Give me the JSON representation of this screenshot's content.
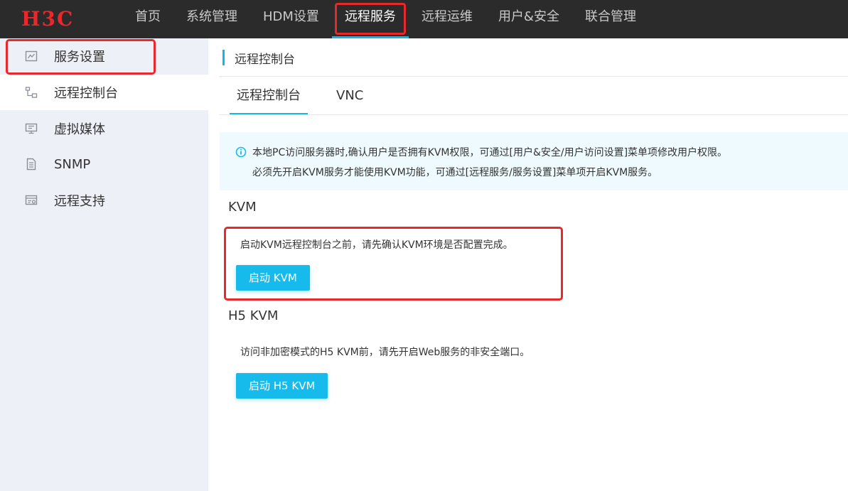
{
  "logo": {
    "text": "H3C",
    "color": "#e8282a"
  },
  "nav": {
    "items": [
      {
        "label": "首页"
      },
      {
        "label": "系统管理"
      },
      {
        "label": "HDM设置"
      },
      {
        "label": "远程服务",
        "active": true
      },
      {
        "label": "远程运维"
      },
      {
        "label": "用户&安全"
      },
      {
        "label": "联合管理"
      }
    ]
  },
  "sidebar": {
    "items": [
      {
        "label": "服务设置",
        "icon": "service-settings-icon"
      },
      {
        "label": "远程控制台",
        "icon": "remote-console-icon",
        "active": true
      },
      {
        "label": "虚拟媒体",
        "icon": "monitor-icon"
      },
      {
        "label": "SNMP",
        "icon": "document-icon"
      },
      {
        "label": "远程支持",
        "icon": "support-icon"
      }
    ]
  },
  "page": {
    "title": "远程控制台",
    "tabs": [
      {
        "label": "远程控制台",
        "active": true
      },
      {
        "label": "VNC"
      }
    ],
    "notice": {
      "line1": "本地PC访问服务器时,确认用户是否拥有KVM权限，可通过[用户&安全/用户访问设置]菜单项修改用户权限。",
      "line2": "必须先开启KVM服务才能使用KVM功能，可通过[远程服务/服务设置]菜单项开启KVM服务。"
    },
    "kvm": {
      "title": "KVM",
      "desc": "启动KVM远程控制台之前，请先确认KVM环境是否配置完成。",
      "button": "启动 KVM"
    },
    "h5kvm": {
      "title": "H5 KVM",
      "desc": "访问非加密模式的H5 KVM前，请先开启Web服务的非安全端口。",
      "button": "启动 H5 KVM"
    }
  },
  "colors": {
    "accent": "#16bbec",
    "highlight": "#e8282a",
    "topbar": "#2b2b2b",
    "sidebar": "#eef0f7"
  }
}
